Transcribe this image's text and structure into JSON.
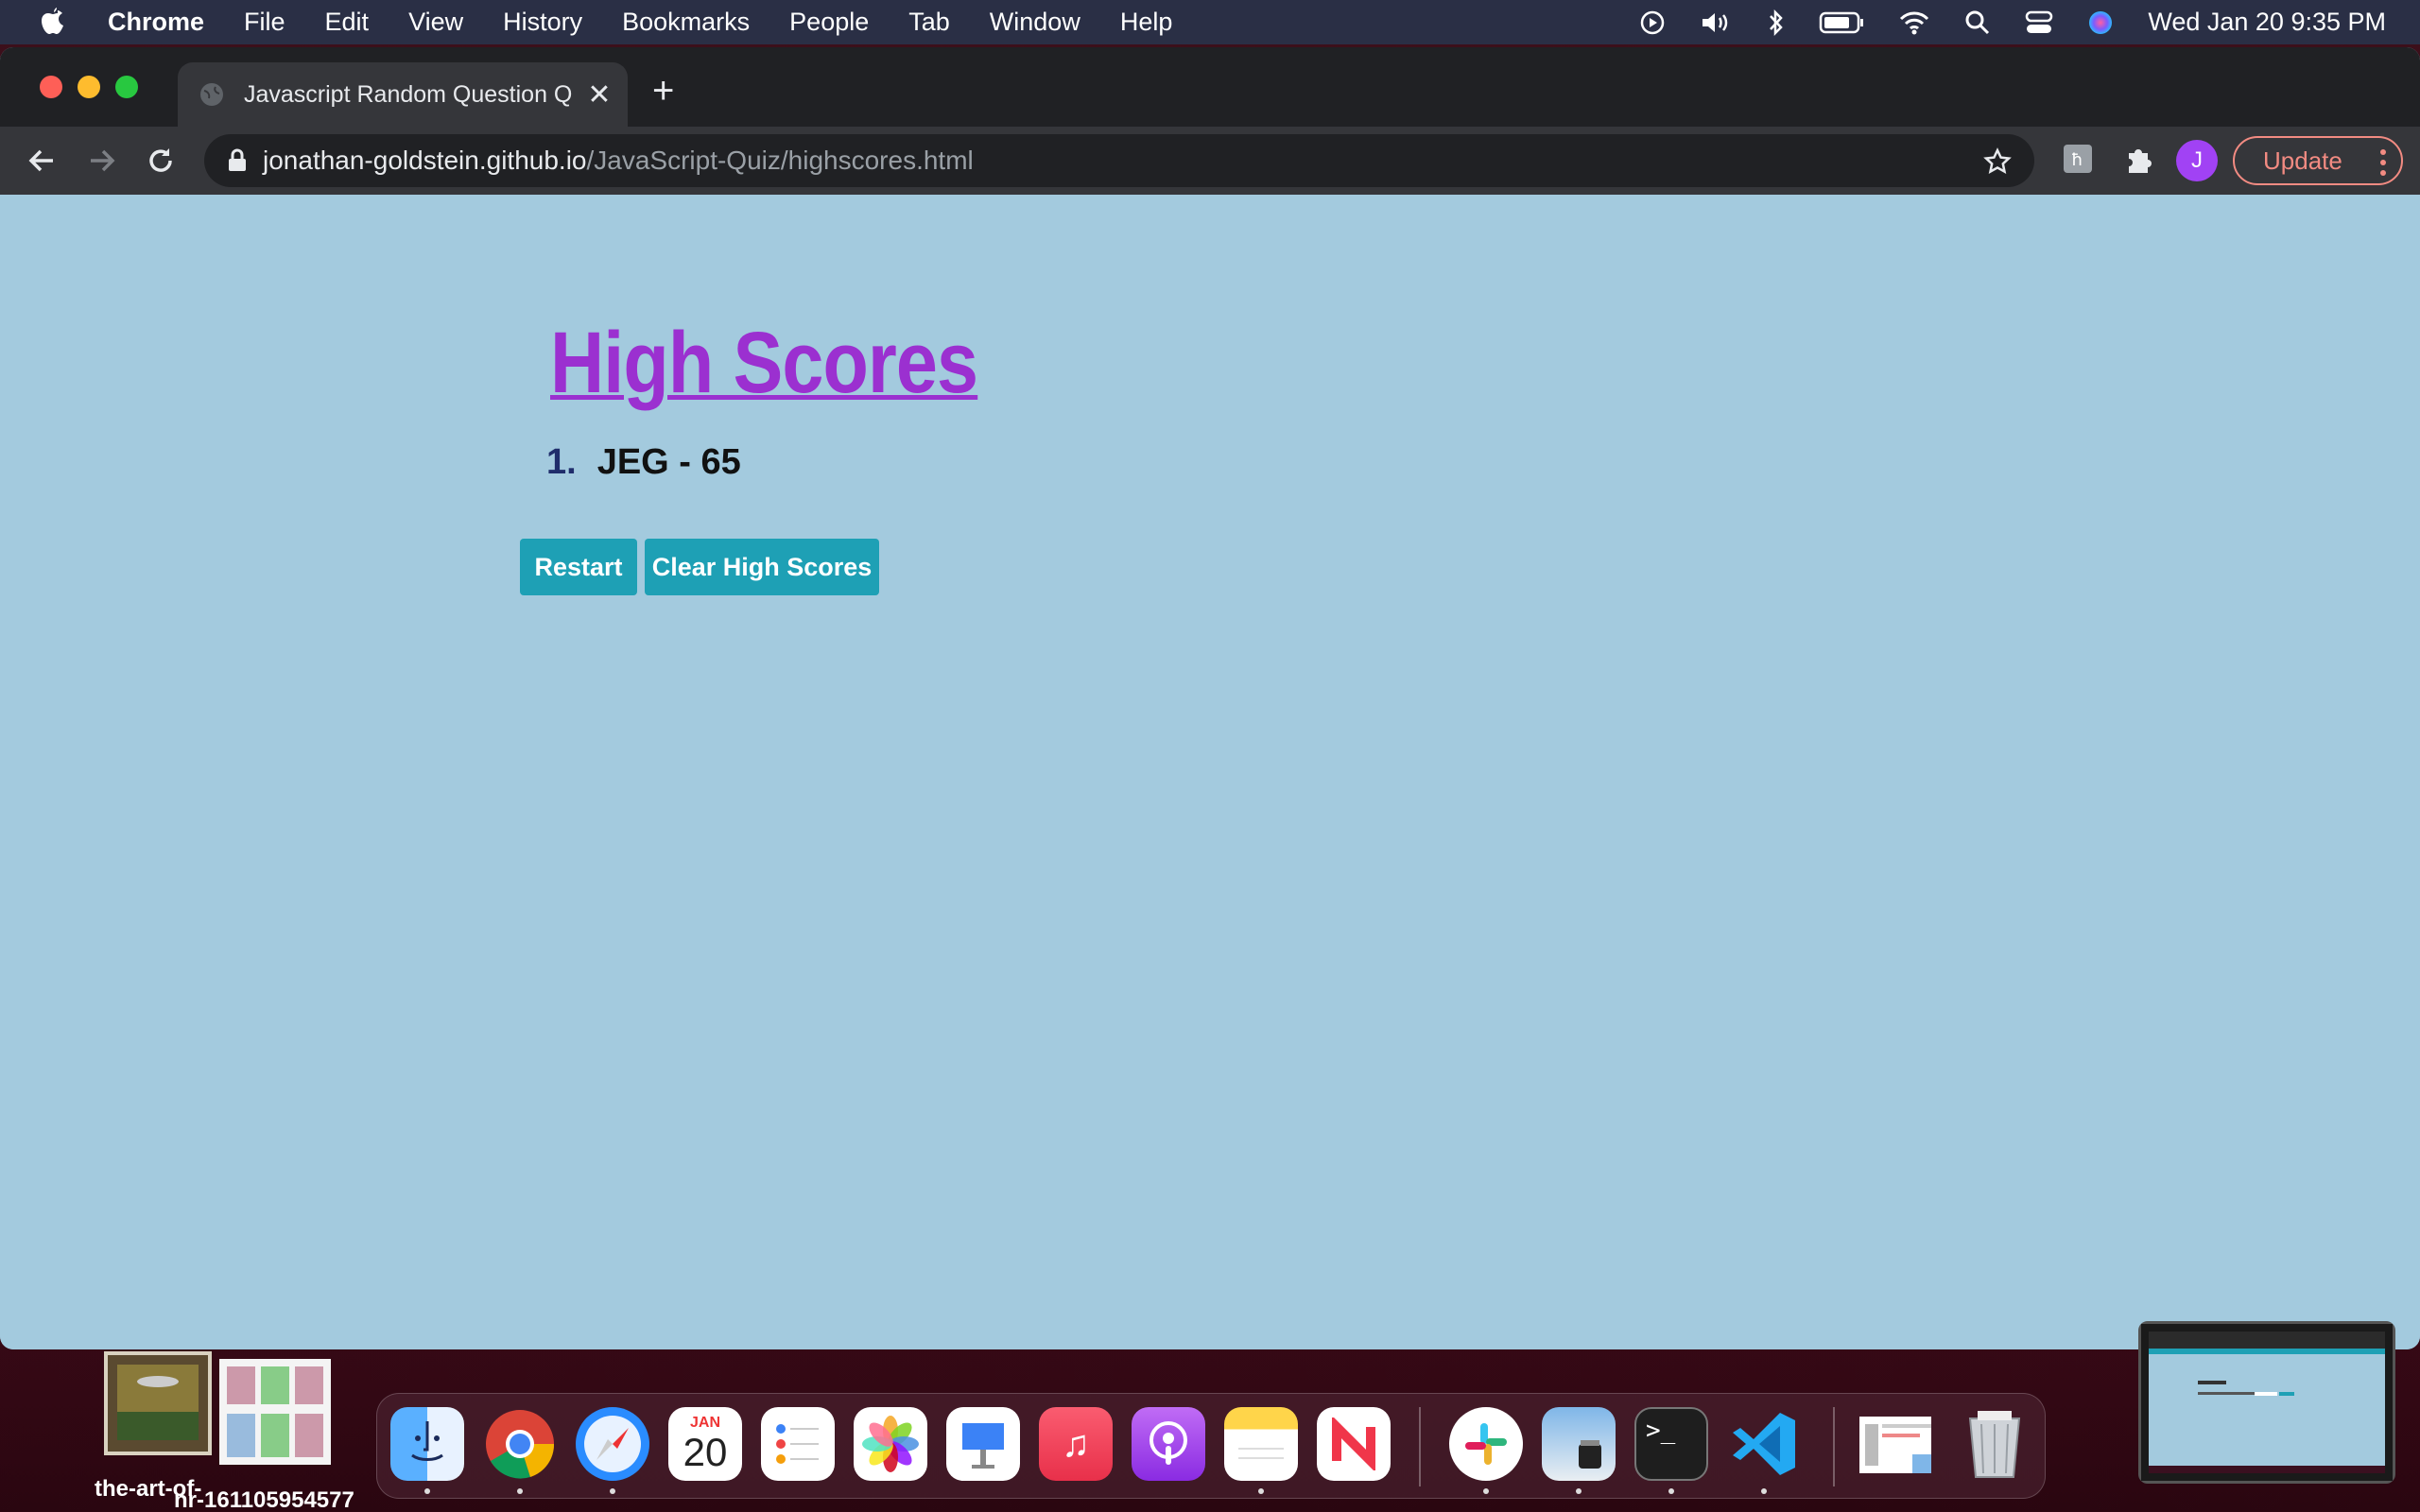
{
  "menubar": {
    "app_name": "Chrome",
    "items": [
      "File",
      "Edit",
      "View",
      "History",
      "Bookmarks",
      "People",
      "Tab",
      "Window",
      "Help"
    ],
    "clock": "Wed Jan 20  9:35 PM"
  },
  "browser": {
    "tab_title": "Javascript Random Question Q",
    "url_host": "jonathan-goldstein.github.io",
    "url_path": "/JavaScript-Quiz/highscores.html",
    "profile_initial": "J",
    "update_label": "Update"
  },
  "page": {
    "title": "High Scores",
    "scores": [
      {
        "rank": "1.",
        "entry": "JEG - 65"
      }
    ],
    "restart_label": "Restart",
    "clear_label": "Clear High Scores"
  },
  "desktop": {
    "file_label_1": "the-art-of-",
    "file_label_2": "nr-161105954577"
  },
  "dock": {
    "calendar_month": "JAN",
    "calendar_day": "20"
  },
  "colors": {
    "page_bg": "#a3cade",
    "title": "#9b30d0",
    "button": "#1ea0b5"
  }
}
